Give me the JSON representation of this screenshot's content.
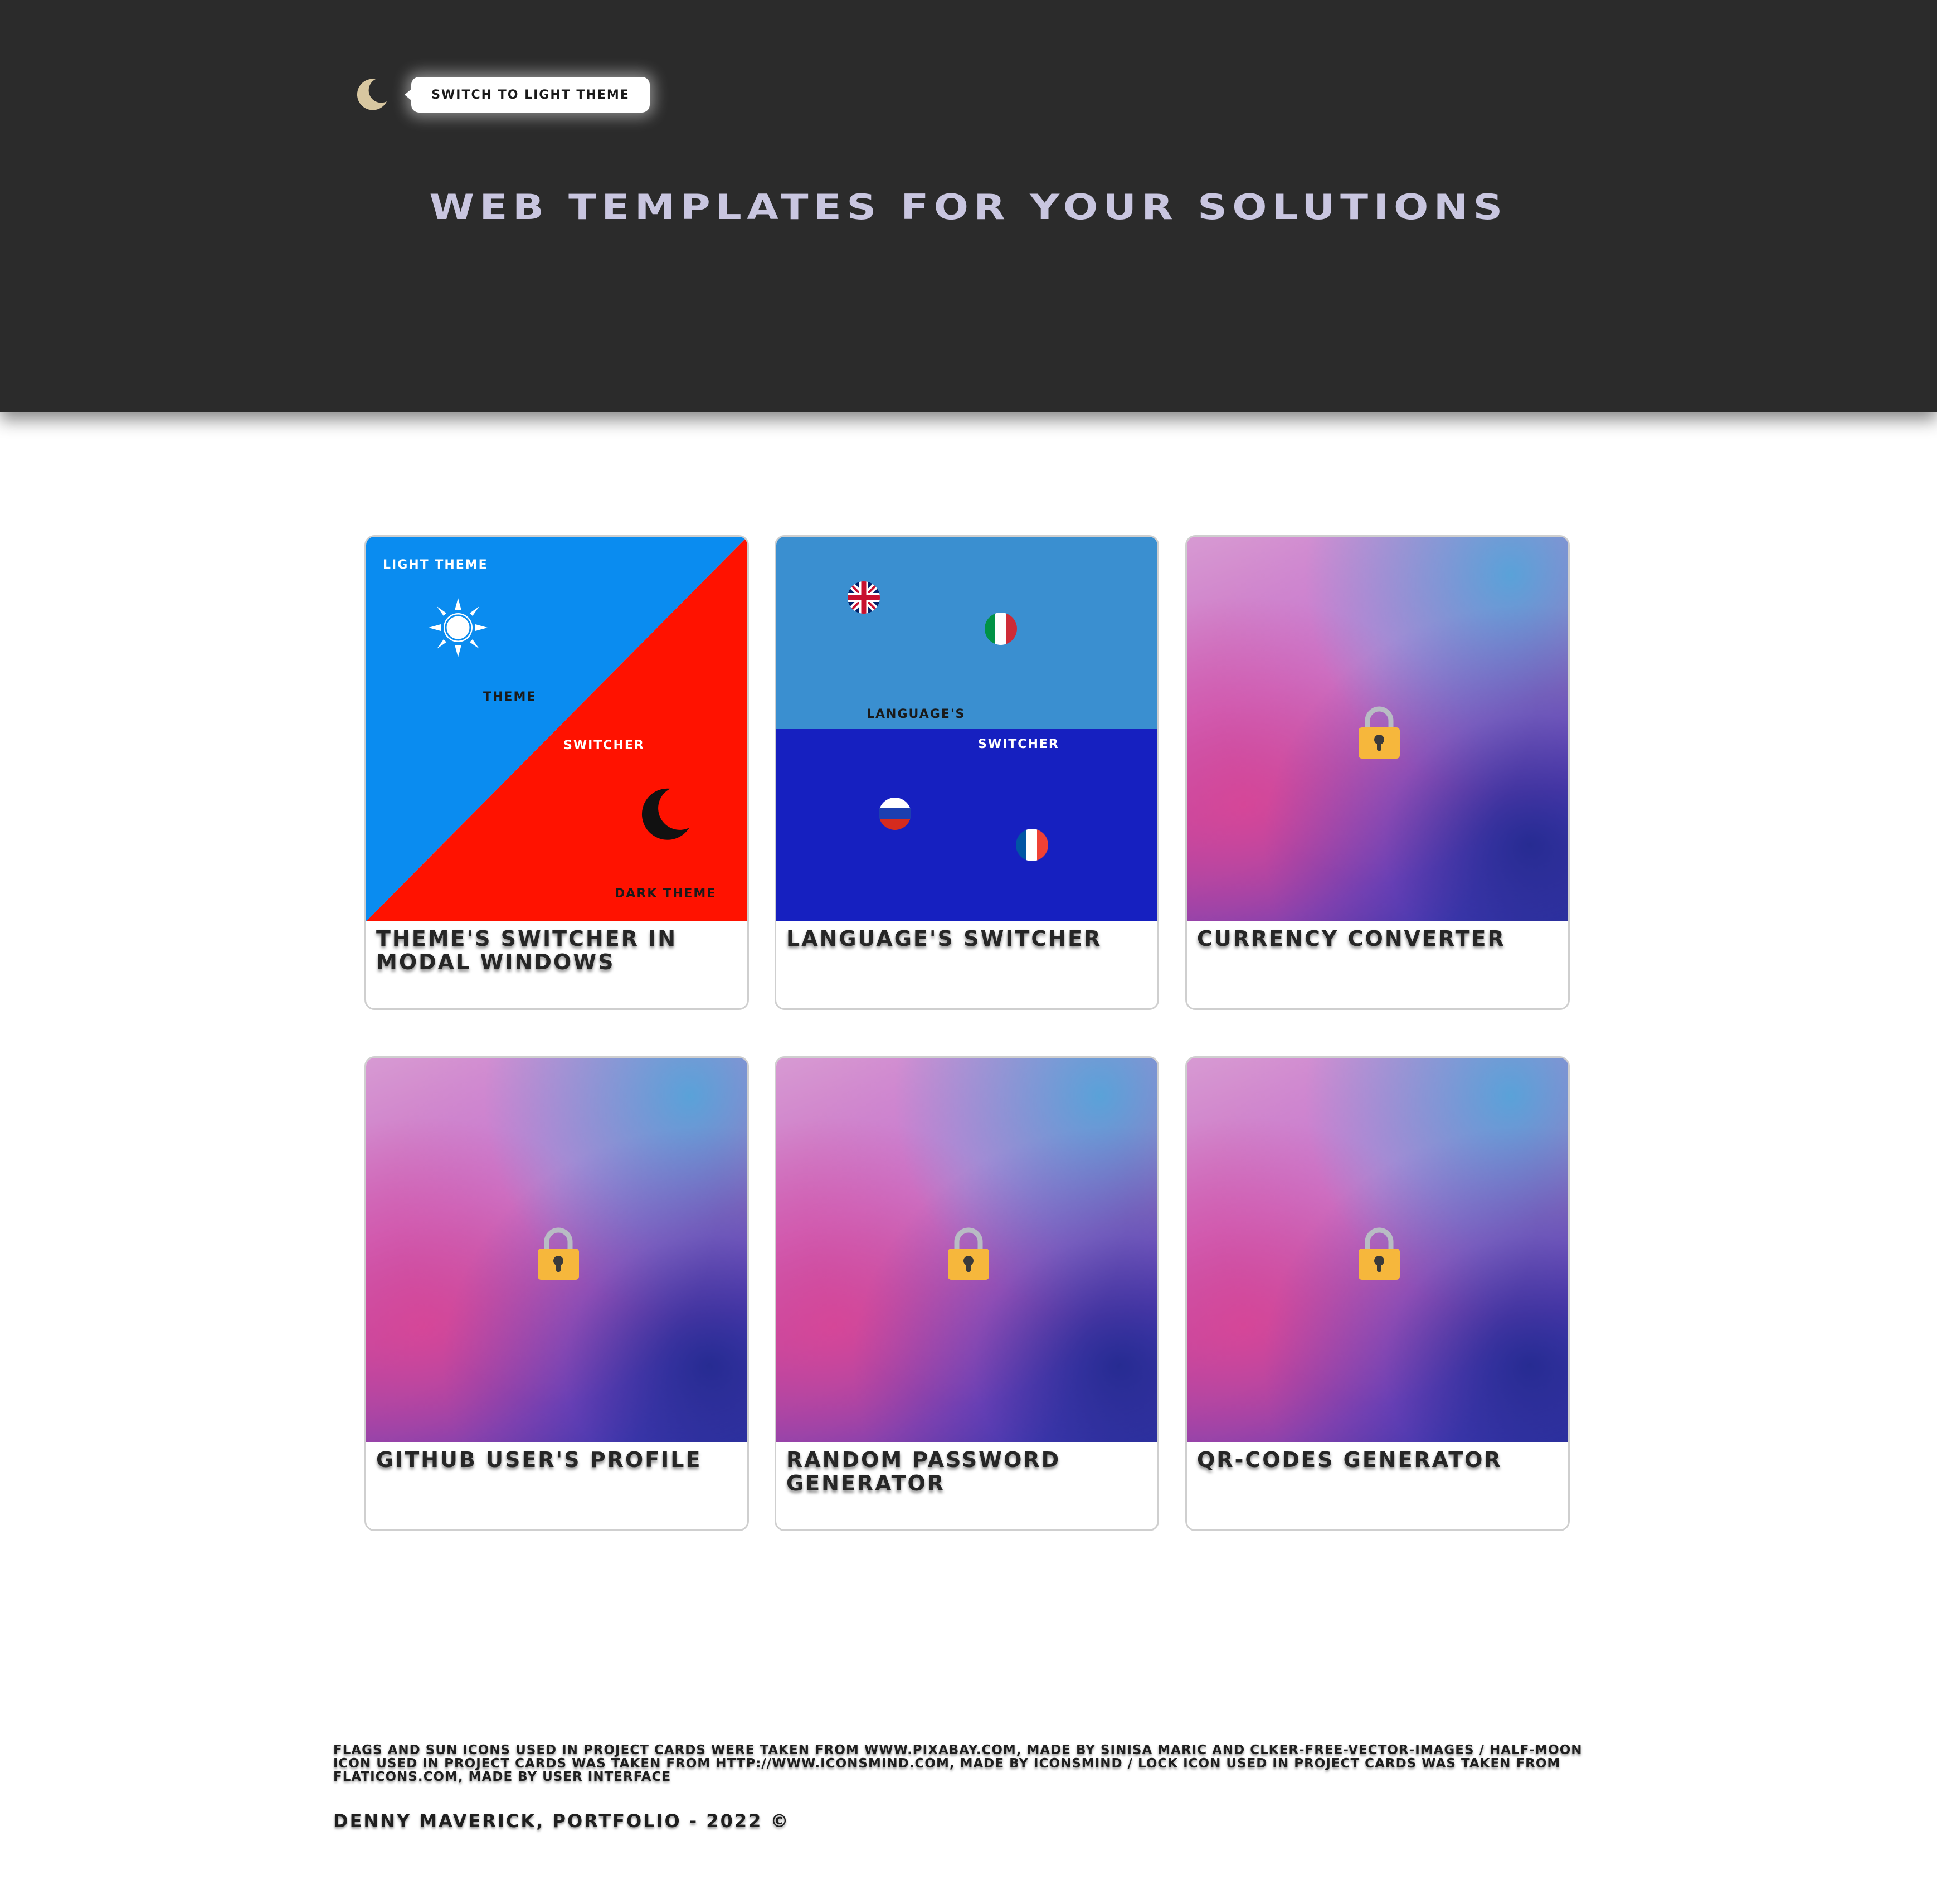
{
  "header": {
    "theme_toggle_icon": "half-moon-icon",
    "theme_tooltip": "SWITCH TO LIGHT THEME",
    "title": "WEB TEMPLATES FOR YOUR SOLUTIONS"
  },
  "colors": {
    "header_bg": "#2b2b2b",
    "title": "#c9c6e0",
    "moon": "#d8c7a0",
    "theme_card_blue": "#0a8cf0",
    "theme_card_red": "#ff1200",
    "lang_card_top": "#3a8fd0",
    "lang_card_bottom": "#1620c0",
    "lock": "#f6b73c"
  },
  "cards": [
    {
      "title": "THEME'S SWITCHER IN MODAL WINDOWS",
      "thumb_labels": {
        "light": "LIGHT THEME",
        "theme": "THEME",
        "switcher": "SWITCHER",
        "dark": "DARK THEME"
      },
      "icons": [
        "sun-icon",
        "half-moon-icon"
      ]
    },
    {
      "title": "LANGUAGE'S SWITCHER",
      "thumb_labels": {
        "language": "LANGUAGE'S",
        "switcher": "SWITCHER"
      },
      "icons": [
        "uk-flag-icon",
        "italy-flag-icon",
        "russia-flag-icon",
        "france-flag-icon"
      ]
    },
    {
      "title": "CURRENCY CONVERTER",
      "icons": [
        "lock-icon"
      ]
    },
    {
      "title": "GITHUB USER'S PROFILE",
      "icons": [
        "lock-icon"
      ]
    },
    {
      "title": "RANDOM PASSWORD GENERATOR",
      "icons": [
        "lock-icon"
      ]
    },
    {
      "title": "QR-CODES GENERATOR",
      "icons": [
        "lock-icon"
      ]
    }
  ],
  "footer": {
    "credits": "FLAGS AND SUN ICONS USED IN PROJECT CARDS WERE TAKEN FROM WWW.PIXABAY.COM, MADE BY SINISA MARIC AND CLKER-FREE-VECTOR-IMAGES / HALF-MOON ICON USED IN PROJECT CARDS WAS TAKEN FROM HTTP://WWW.ICONSMIND.COM, MADE BY ICONSMIND / LOCK ICON USED IN PROJECT CARDS WAS TAKEN FROM FLATICONS.COM, MADE BY USER INTERFACE",
    "copyright": "DENNY MAVERICK, PORTFOLIO - 2022 ©"
  }
}
